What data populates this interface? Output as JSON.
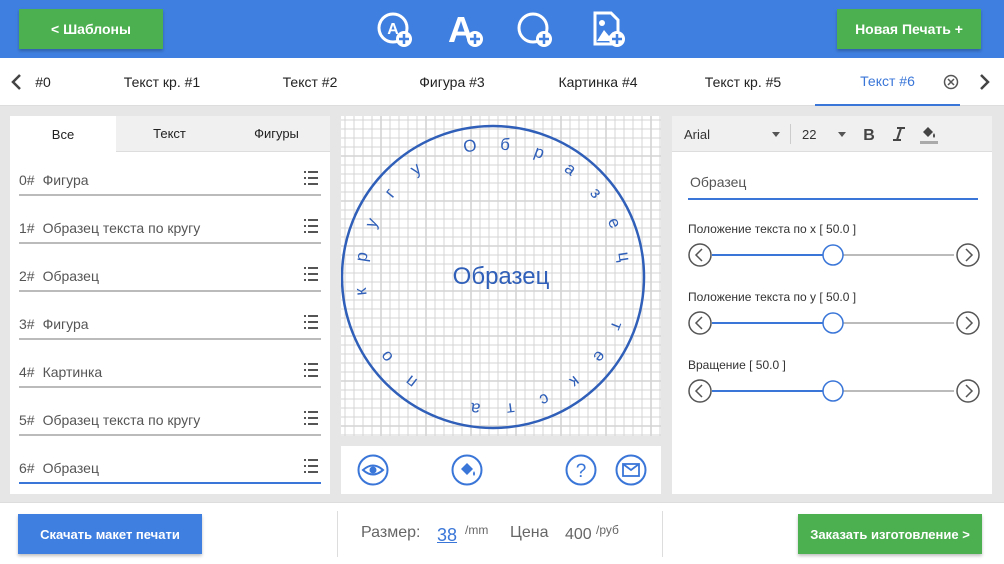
{
  "header": {
    "templates_label": "<  Шаблоны",
    "new_print_label": "Новая Печать +"
  },
  "tabs": [
    {
      "label": "#0"
    },
    {
      "label": "Текст кр. #1"
    },
    {
      "label": "Текст #2"
    },
    {
      "label": "Фигура #3"
    },
    {
      "label": "Картинка #4"
    },
    {
      "label": "Текст кр. #5"
    },
    {
      "label": "Текст #6",
      "active": true
    }
  ],
  "left_panel": {
    "subtabs": [
      {
        "label": "Все",
        "active": true
      },
      {
        "label": "Текст"
      },
      {
        "label": "Фигуры"
      }
    ],
    "items": [
      {
        "num": "0#",
        "label": "Фигура"
      },
      {
        "num": "1#",
        "label": "Образец текста по кругу"
      },
      {
        "num": "2#",
        "label": "Образец"
      },
      {
        "num": "3#",
        "label": "Фигура"
      },
      {
        "num": "4#",
        "label": "Картинка"
      },
      {
        "num": "5#",
        "label": "Образец текста по кругу"
      },
      {
        "num": "6#",
        "label": "Образец",
        "active": true
      }
    ]
  },
  "canvas": {
    "center_text": "Образец",
    "circle_text": "Образец текста по кругу"
  },
  "right_panel": {
    "font": "Arial",
    "size": "22",
    "text_value": "Образец",
    "sliders": [
      {
        "label": "Положение текста по x [ 50.0 ]",
        "value": 50.0
      },
      {
        "label": "Положение текста по y [ 50.0 ]",
        "value": 50.0
      },
      {
        "label": "Вращение [ 50.0 ]",
        "value": 50.0
      }
    ]
  },
  "footer": {
    "download_label": "Скачать макет печати",
    "size_label": "Размер:",
    "size_value": "38",
    "size_unit": "/mm",
    "price_label": "Цена",
    "price_value": "400",
    "price_unit": "/руб",
    "order_label": "Заказать изготовление >"
  },
  "colors": {
    "header": "#3f7fe0",
    "accent": "#3a76d8",
    "green": "#4caf50",
    "stamp": "#2f5fb8"
  }
}
